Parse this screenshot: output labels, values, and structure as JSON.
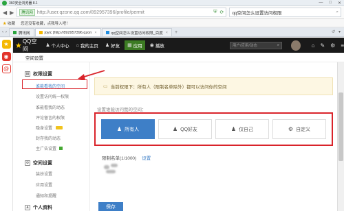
{
  "browser": {
    "window_title": "360安全浏览器 8.1",
    "window_controls": [
      "—",
      "□",
      "✕"
    ],
    "url_badge": "腾讯网",
    "url": "http://user.qzone.qq.com/892957396/profile/permit",
    "search_text": "qq空间怎么设置访问权限",
    "fav_label": "收藏",
    "fav_hint": "您还没有收藏，点我导入吧！",
    "tabs": [
      {
        "label": "腾讯网",
        "active": false
      },
      {
        "label": "joyic [http://892957396.qzon",
        "active": true
      },
      {
        "label": "qq空间怎么设置访问权限_百度",
        "active": false
      }
    ]
  },
  "qzone": {
    "logo_text": "QQ空间",
    "nav": [
      {
        "icon": "♟",
        "label": "个人中心"
      },
      {
        "icon": "⌂",
        "label": "我的主页"
      },
      {
        "icon": "♟",
        "label": "好友"
      },
      {
        "icon": "▦",
        "label": "应用"
      },
      {
        "icon": "◉",
        "label": "播放"
      }
    ],
    "search_placeholder": "用户/应用/动态",
    "subhead": "空间设置"
  },
  "sidebar": {
    "sections": [
      {
        "title": "权限设置",
        "items": [
          "谁能看我的空间",
          "设置访问统一权限",
          "谁能看我的动态",
          "评论留言的权限",
          "隐身设置",
          "封存我的动态",
          "主广告设置"
        ]
      },
      {
        "title": "空间设置",
        "items": [
          "装扮设置",
          "应用设置",
          "通知和提醒"
        ]
      },
      {
        "title": "个人资料",
        "items": []
      }
    ]
  },
  "main": {
    "notice": "当前权限下：所有人（限制名单除外）都可以访问你的空间",
    "question": "设置谁能访问我的空间：",
    "options": [
      {
        "label": "所有人",
        "icon": "♟",
        "selected": true
      },
      {
        "label": "QQ好友",
        "icon": "♟",
        "selected": false
      },
      {
        "label": "仅自己",
        "icon": "♟",
        "selected": false
      },
      {
        "label": "自定义",
        "icon": "⚙",
        "selected": false
      }
    ],
    "limit_label": "限制名单(1/1000)",
    "limit_link": "设置",
    "save_label": "保存"
  },
  "colors": {
    "highlight_red": "#d9232a",
    "accent_blue": "#3e7fc7",
    "header_black": "#1a1a1a"
  }
}
